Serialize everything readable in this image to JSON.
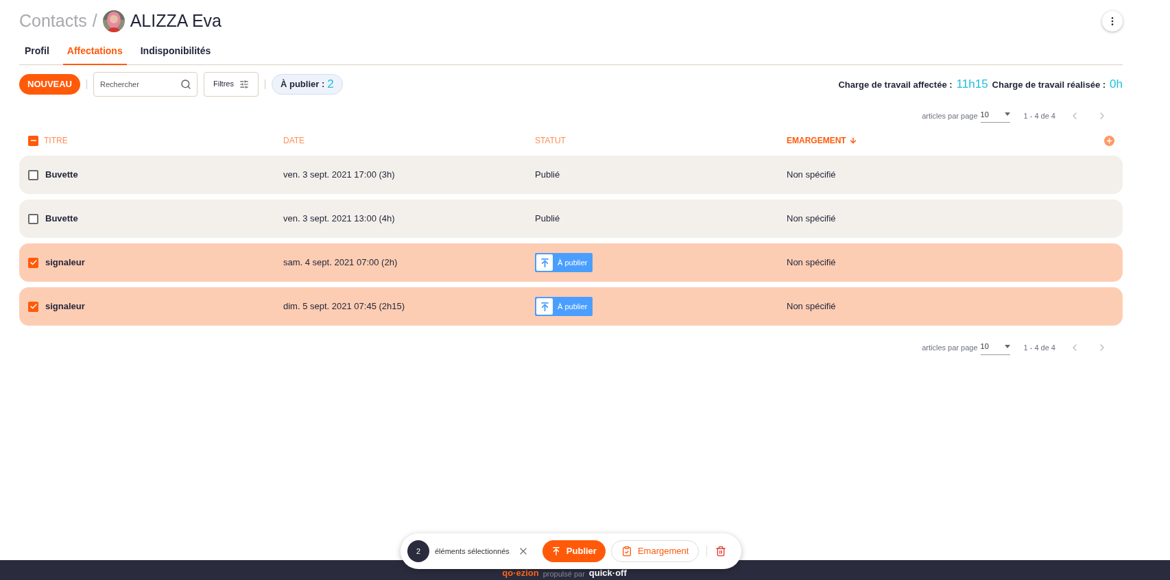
{
  "breadcrumb": {
    "parent": "Contacts",
    "separator": "/",
    "name": "ALIZZA Eva"
  },
  "tabs": [
    {
      "label": "Profil",
      "selected": false
    },
    {
      "label": "Affectations",
      "selected": true
    },
    {
      "label": "Indisponibilités",
      "selected": false
    }
  ],
  "toolbar": {
    "new_button": "NOUVEAU",
    "search": {
      "placeholder": "Rechercher"
    },
    "filters_button": "Filtres",
    "to_publish": {
      "label": "À publier :",
      "count": "2"
    }
  },
  "workload": [
    {
      "label": "Charge de travail affectée :",
      "value": "11h15"
    },
    {
      "label": "Charge de travail réalisée :",
      "value": "0h"
    }
  ],
  "pagination": [
    {
      "label": "articles par page",
      "page_size": "10",
      "range": "1 - 4 de 4"
    },
    {
      "label": "articles par page",
      "page_size": "10",
      "range": "1 - 4 de 4"
    }
  ],
  "table": {
    "indeterminate": true,
    "columns": [
      {
        "label": "TITRE",
        "sorted": false
      },
      {
        "label": "DATE",
        "sorted": false
      },
      {
        "label": "STATUT",
        "sorted": false
      },
      {
        "label": "EMARGEMENT",
        "sorted": true
      }
    ],
    "rows": [
      {
        "checked": false,
        "title": "Buvette",
        "date": "ven. 3 sept. 2021 17:00 (3h)",
        "status": {
          "kind": "text",
          "label": "Publié"
        },
        "signing": "Non spécifié"
      },
      {
        "checked": false,
        "title": "Buvette",
        "date": "ven. 3 sept. 2021 13:00 (4h)",
        "status": {
          "kind": "text",
          "label": "Publié"
        },
        "signing": "Non spécifié"
      },
      {
        "checked": true,
        "title": "signaleur",
        "date": "sam. 4 sept. 2021 07:00 (2h)",
        "status": {
          "kind": "badge",
          "label": "À publier"
        },
        "signing": "Non spécifié"
      },
      {
        "checked": true,
        "title": "signaleur",
        "date": "dim. 5 sept. 2021 07:45 (2h15)",
        "status": {
          "kind": "badge",
          "label": "À publier"
        },
        "signing": "Non spécifié"
      }
    ]
  },
  "selection_bar": {
    "count": "2",
    "label": "éléments sélectionnés",
    "publish_button": "Publier",
    "signing_button": "Emargement"
  },
  "footer": {
    "brand": "qo·ezion",
    "powered_by": "propulsé par",
    "vendor": "quick·off"
  }
}
